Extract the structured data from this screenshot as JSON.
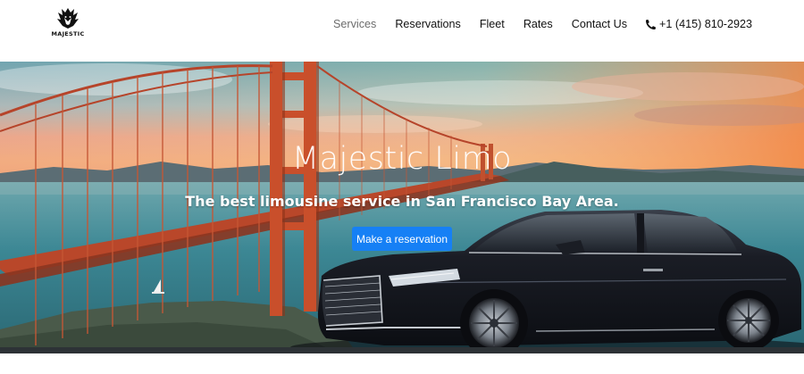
{
  "brand": {
    "logo_text": "MAJESTIC",
    "logo_icon": "crowned-lion-emblem-icon"
  },
  "nav": {
    "items": [
      {
        "label": "Services",
        "active": true
      },
      {
        "label": "Reservations",
        "active": false
      },
      {
        "label": "Fleet",
        "active": false
      },
      {
        "label": "Rates",
        "active": false
      },
      {
        "label": "Contact Us",
        "active": false
      }
    ],
    "phone": {
      "icon": "phone-icon",
      "label": "+1 (415) 810-2923"
    }
  },
  "hero": {
    "title": "Majestic Limo",
    "subtitle": "The best limousine service in San Francisco Bay Area.",
    "cta_label": "Make a reservation",
    "background": "golden-gate-bridge-with-black-sedan",
    "colors": {
      "cta": "#1680f5",
      "sky_top": "#4fb3c9",
      "sky_sunset": "#f0a27a",
      "water": "#3d8795",
      "bridge": "#c5512c",
      "car": "#14161c"
    }
  }
}
